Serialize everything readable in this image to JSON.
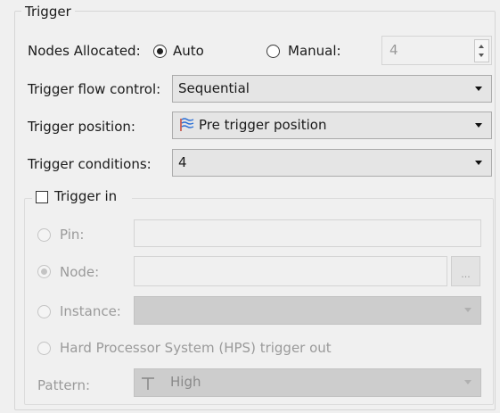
{
  "group": {
    "title": "Trigger"
  },
  "nodes_allocated": {
    "label": "Nodes Allocated:",
    "auto_label": "Auto",
    "manual_label": "Manual:",
    "manual_value": "4",
    "selected": "auto"
  },
  "flow_control": {
    "label": "Trigger flow control:",
    "value": "Sequential"
  },
  "position": {
    "label": "Trigger position:",
    "value": "Pre trigger position",
    "icon": "pre-trigger-icon"
  },
  "conditions": {
    "label": "Trigger conditions:",
    "value": "4"
  },
  "trigger_in": {
    "label": "Trigger in",
    "checked": false,
    "pin_label": "Pin:",
    "node_label": "Node:",
    "browse_label": "...",
    "instance_label": "Instance:",
    "hps_label": "Hard Processor System (HPS) trigger out",
    "pattern_label": "Pattern:",
    "pattern_value": "High",
    "pattern_icon": "high-level-icon",
    "selected": "node"
  }
}
